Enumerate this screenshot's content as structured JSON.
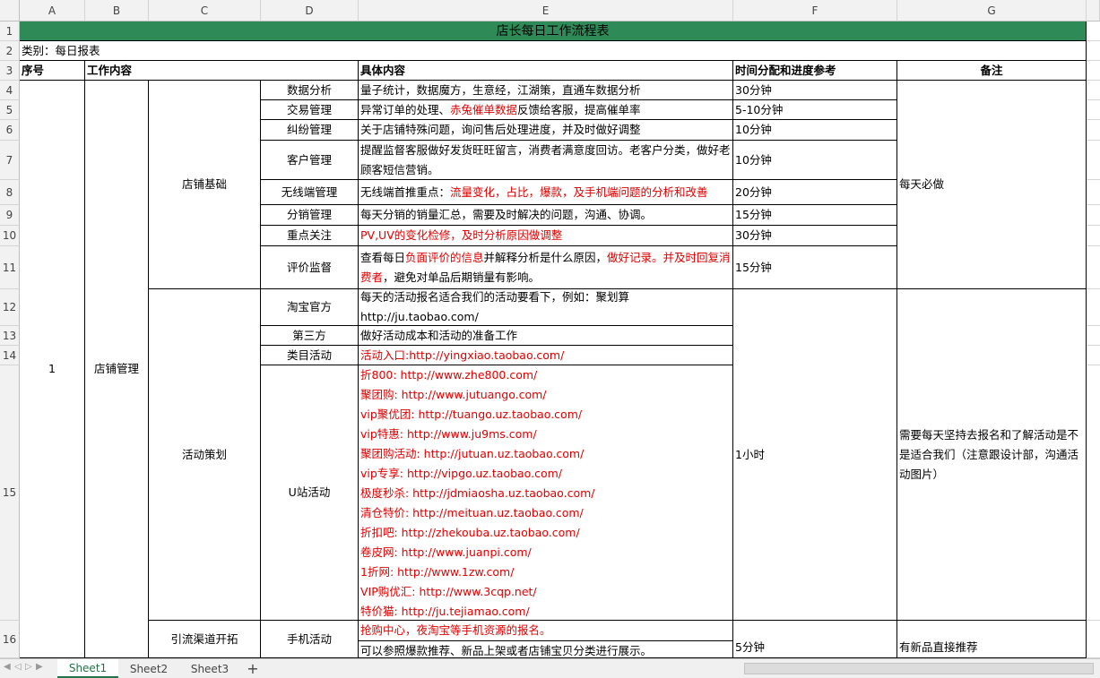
{
  "columns": [
    "A",
    "B",
    "C",
    "D",
    "E",
    "F",
    "G"
  ],
  "rows": [
    "1",
    "2",
    "3",
    "4",
    "5",
    "6",
    "7",
    "8",
    "9",
    "10",
    "11",
    "12",
    "13",
    "14",
    "15",
    "16"
  ],
  "title": "店长每日工作流程表",
  "category": "类别：每日报表",
  "headers": {
    "seq": "序号",
    "work": "工作内容",
    "detail": "具体内容",
    "time": "时间分配和进度参考",
    "remark": "备注"
  },
  "seq_value": "1",
  "section_main": "店铺管理",
  "group_basic": "店铺基础",
  "group_activity": "活动策划",
  "group_traffic": "引流渠道开拓",
  "basic_items": [
    {
      "name": "数据分析",
      "parts": [
        {
          "t": "量子统计，数据魔方，生意经，江湖策，直通车数据分析",
          "r": false
        }
      ],
      "time": "30分钟"
    },
    {
      "name": "交易管理",
      "parts": [
        {
          "t": "异常订单的处理、",
          "r": false
        },
        {
          "t": "赤兔催单数据",
          "r": true
        },
        {
          "t": "反馈给客服，提高催单率",
          "r": false
        }
      ],
      "time": "5-10分钟"
    },
    {
      "name": "纠纷管理",
      "parts": [
        {
          "t": "关于店铺特殊问题，询问售后处理进度，并及时做好调整",
          "r": false
        }
      ],
      "time": "10分钟"
    },
    {
      "name": "客户管理",
      "parts": [
        {
          "t": "提醒监督客服做好发货旺旺留言，消费者满意度回访。老客户分类，做好老顾客短信营销。",
          "r": false
        }
      ],
      "time": "10分钟"
    },
    {
      "name": "无线端管理",
      "parts": [
        {
          "t": "无线端首推重点：",
          "r": false
        },
        {
          "t": "流量变化，占比，爆款，及手机端问题的分析和改善",
          "r": true
        }
      ],
      "time": "20分钟"
    },
    {
      "name": "分销管理",
      "parts": [
        {
          "t": "每天分销的销量汇总，需要及时解决的问题，沟通、协调。",
          "r": false
        }
      ],
      "time": "15分钟"
    },
    {
      "name": "重点关注",
      "parts": [
        {
          "t": "PV,UV的变化检修，及时分析原因做调整",
          "r": true
        }
      ],
      "time": "30分钟"
    },
    {
      "name": "评价监督",
      "parts": [
        {
          "t": "查看每日",
          "r": false
        },
        {
          "t": "负面评价的信息",
          "r": true
        },
        {
          "t": "并解释分析是什么原因，",
          "r": false
        },
        {
          "t": "做好记录。并及时回复消费者",
          "r": true
        },
        {
          "t": "，避免对单品后期销量有影响。",
          "r": false
        }
      ],
      "time": "15分钟"
    }
  ],
  "basic_remark": "每天必做",
  "activity_items": {
    "taobao": {
      "name": "淘宝官方",
      "text": "每天的活动报名适合我们的活动要看下，例如：聚划算 http://ju.taobao.com/"
    },
    "third": {
      "name": "第三方",
      "text": "做好活动成本和活动的准备工作"
    },
    "category": {
      "name": "类目活动",
      "text": "活动入口:http://yingxiao.taobao.com/"
    },
    "ustation": {
      "name": "U站活动",
      "lines": [
        "折800: http://www.zhe800.com/",
        "聚团购: http://www.jutuango.com/",
        "vip聚优团: http://tuango.uz.taobao.com/",
        "vip特惠: http://www.ju9ms.com/",
        "聚团购活动: http://jutuan.uz.taobao.com/",
        "vip专享: http://vipgo.uz.taobao.com/",
        "极度秒杀: http://jdmiaosha.uz.taobao.com/",
        "清仓特价: http://meituan.uz.taobao.com/",
        "折扣吧: http://zhekouba.uz.taobao.com/",
        "卷皮网: http://www.juanpi.com/",
        "1折网: http://www.1zw.com/",
        "VIP购优汇: http://www.3cqp.net/",
        "特价猫: http://ju.tejiamao.com/"
      ]
    }
  },
  "activity_time": "1小时",
  "activity_remark": "需要每天坚持去报名和了解活动是不是适合我们（注意跟设计部，沟通活动图片）",
  "traffic": {
    "name": "手机活动",
    "line1": "抢购中心，夜淘宝等手机资源的报名。",
    "line2": "可以参照爆款推荐、新品上架或者店铺宝贝分类进行展示。",
    "time": "5分钟",
    "remark": "有新品直接推荐"
  },
  "sheets": [
    "Sheet1",
    "Sheet2",
    "Sheet3"
  ],
  "add_sheet": "+",
  "colors": {
    "title_bg": "#2e8b57",
    "red_text": "#e00000",
    "active_tab": "#217346"
  }
}
